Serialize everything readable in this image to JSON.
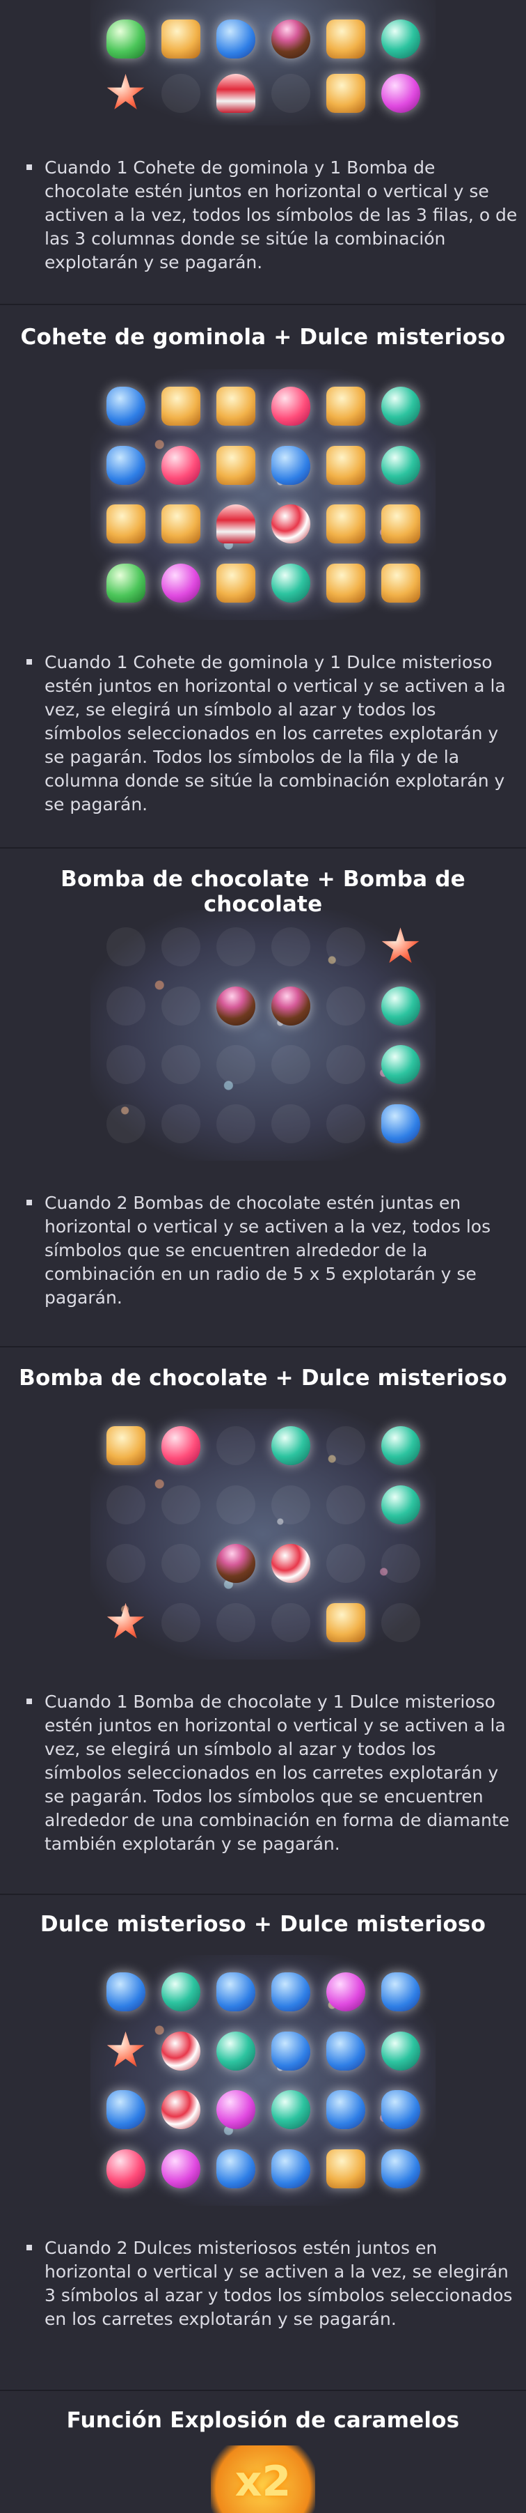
{
  "intro": {
    "text": "Cuando 1 Cohete de gominola y 1 Bomba de chocolate estén juntos en horizontal o vertical y se activen a la vez, todos los símbolos de las 3 filas, o de las 3 columnas donde se sitúe la combinación explotarán y se pagarán."
  },
  "sections": [
    {
      "title": "Cohete de gominola + Dulce misterioso",
      "text": "Cuando 1 Cohete de gominola y 1 Dulce misterioso estén juntos en horizontal o vertical y se activen a la vez, se elegirá un símbolo al azar y todos los símbolos seleccionados en los carretes explotarán y se pagarán. Todos los símbolos de la fila y de la columna donde se sitúe la combinación explotarán y se pagarán."
    },
    {
      "title": "Bomba de chocolate + Bomba de chocolate",
      "text": "Cuando 2 Bombas de chocolate estén juntas en horizontal o vertical y se activen a la vez, todos los símbolos que se encuentren alrededor de la combinación en un radio de 5 x 5 explotarán y se pagarán."
    },
    {
      "title": "Bomba de chocolate + Dulce misterioso",
      "text": "Cuando 1 Bomba de chocolate y 1 Dulce misterioso estén juntos en horizontal o vertical y se activen a la vez, se elegirá un símbolo al azar y todos los símbolos seleccionados en los carretes explotarán y se pagarán. Todos los símbolos que se encuentren alrededor de una combinación en forma de diamante también explotarán y se pagarán."
    },
    {
      "title": "Dulce misterioso + Dulce misterioso",
      "text": "Cuando 2 Dulces misteriosos estén juntos en horizontal o vertical y se activen a la vez, se elegirán 3 símbolos al azar y todos los símbolos seleccionados en los carretes explotarán y se pagarán."
    },
    {
      "title": "Función Explosión de caramelos",
      "text": ""
    }
  ],
  "multiplier_badge": "x2",
  "icons": {
    "bullet": "square-bullet-icon",
    "symbols": [
      "blue-candy-icon",
      "teal-candy-icon",
      "heart-candy-icon",
      "cake-candy-icon",
      "pink-donut-icon",
      "green-gummy-icon",
      "star-candy-icon",
      "mystery-candy-icon",
      "chocolate-bomb-icon",
      "jelly-rocket-icon"
    ]
  }
}
